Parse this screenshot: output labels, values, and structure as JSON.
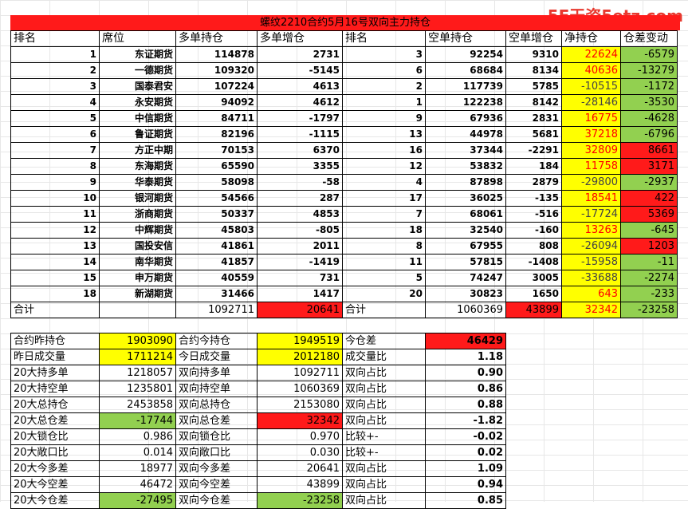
{
  "watermark": "5E天资5etz.com",
  "title": "螺纹2210合约5月16号双向主力持仓",
  "headers": [
    "排名",
    "席位",
    "多单持仓",
    "多单增仓",
    "排名",
    "空单持仓",
    "空单增仓",
    "净持仓",
    "仓差变动"
  ],
  "rows": [
    {
      "rank": "1",
      "seat": "东证期货",
      "long": "114878",
      "long_chg": "2731",
      "srank": "3",
      "short": "92254",
      "short_chg": "9310",
      "net": "22624",
      "diff": "-6579"
    },
    {
      "rank": "2",
      "seat": "一德期货",
      "long": "109320",
      "long_chg": "-5145",
      "srank": "6",
      "short": "68684",
      "short_chg": "8134",
      "net": "40636",
      "diff": "-13279"
    },
    {
      "rank": "3",
      "seat": "国泰君安",
      "long": "107224",
      "long_chg": "4613",
      "srank": "2",
      "short": "117739",
      "short_chg": "5785",
      "net": "-10515",
      "diff": "-1172"
    },
    {
      "rank": "4",
      "seat": "永安期货",
      "long": "94092",
      "long_chg": "4612",
      "srank": "1",
      "short": "122238",
      "short_chg": "8142",
      "net": "-28146",
      "diff": "-3530"
    },
    {
      "rank": "5",
      "seat": "中信期货",
      "long": "84711",
      "long_chg": "-1797",
      "srank": "9",
      "short": "67936",
      "short_chg": "2831",
      "net": "16775",
      "diff": "-4628"
    },
    {
      "rank": "6",
      "seat": "鲁证期货",
      "long": "82196",
      "long_chg": "-1115",
      "srank": "13",
      "short": "44978",
      "short_chg": "5681",
      "net": "37218",
      "diff": "-6796"
    },
    {
      "rank": "7",
      "seat": "方正中期",
      "long": "70153",
      "long_chg": "6370",
      "srank": "16",
      "short": "37344",
      "short_chg": "-2291",
      "net": "32809",
      "diff": "8661"
    },
    {
      "rank": "8",
      "seat": "东海期货",
      "long": "65590",
      "long_chg": "3355",
      "srank": "12",
      "short": "53832",
      "short_chg": "184",
      "net": "11758",
      "diff": "3171"
    },
    {
      "rank": "9",
      "seat": "华泰期货",
      "long": "58098",
      "long_chg": "-58",
      "srank": "4",
      "short": "87898",
      "short_chg": "2879",
      "net": "-29800",
      "diff": "-2937"
    },
    {
      "rank": "10",
      "seat": "银河期货",
      "long": "54566",
      "long_chg": "287",
      "srank": "17",
      "short": "36025",
      "short_chg": "-135",
      "net": "18541",
      "diff": "422"
    },
    {
      "rank": "11",
      "seat": "浙商期货",
      "long": "50337",
      "long_chg": "4853",
      "srank": "7",
      "short": "68061",
      "short_chg": "-516",
      "net": "-17724",
      "diff": "5369"
    },
    {
      "rank": "12",
      "seat": "中辉期货",
      "long": "45803",
      "long_chg": "-805",
      "srank": "18",
      "short": "32540",
      "short_chg": "-160",
      "net": "13263",
      "diff": "-645"
    },
    {
      "rank": "13",
      "seat": "国投安信",
      "long": "41861",
      "long_chg": "2011",
      "srank": "8",
      "short": "67955",
      "short_chg": "808",
      "net": "-26094",
      "diff": "1203"
    },
    {
      "rank": "14",
      "seat": "南华期货",
      "long": "41857",
      "long_chg": "-1419",
      "srank": "11",
      "short": "57815",
      "short_chg": "-1408",
      "net": "-15958",
      "diff": "-11"
    },
    {
      "rank": "15",
      "seat": "申万期货",
      "long": "40559",
      "long_chg": "731",
      "srank": "5",
      "short": "74247",
      "short_chg": "3005",
      "net": "-33688",
      "diff": "-2274"
    },
    {
      "rank": "18",
      "seat": "新湖期货",
      "long": "31466",
      "long_chg": "1417",
      "srank": "20",
      "short": "30823",
      "short_chg": "1650",
      "net": "643",
      "diff": "-233"
    }
  ],
  "total": {
    "label": "合计",
    "long": "1092711",
    "long_chg": "20641",
    "slabel": "合计",
    "short": "1060369",
    "short_chg": "43899",
    "net": "32342",
    "diff": "-23258"
  },
  "summary": [
    {
      "l1": "合约昨持仓",
      "v1": "1903090",
      "l2": "合约今持仓",
      "v2": "1949519",
      "l3": "今仓差",
      "v3": "46429"
    },
    {
      "l1": "昨日成交量",
      "v1": "1711214",
      "l2": "今日成交量",
      "v2": "2012180",
      "l3": "成交量比",
      "v3": "1.18"
    },
    {
      "l1": "20大持多单",
      "v1": "1218057",
      "l2": "双向持多单",
      "v2": "1092711",
      "l3": "双向占比",
      "v3": "0.90"
    },
    {
      "l1": "20大持空单",
      "v1": "1235801",
      "l2": "双向持空单",
      "v2": "1060369",
      "l3": "双向占比",
      "v3": "0.86"
    },
    {
      "l1": "20大总持仓",
      "v1": "2453858",
      "l2": "双向总持仓",
      "v2": "2153080",
      "l3": "双向占比",
      "v3": "0.88"
    },
    {
      "l1": "20大总仓差",
      "v1": "-17744",
      "l2": "双向总仓差",
      "v2": "32342",
      "l3": "双向占比",
      "v3": "-1.82"
    },
    {
      "l1": "20大锁仓比",
      "v1": "0.986",
      "l2": "双向锁仓比",
      "v2": "0.970",
      "l3": "比较+-",
      "v3": "-0.02"
    },
    {
      "l1": "20大敞口比",
      "v1": "0.014",
      "l2": "双向敞口比",
      "v2": "0.030",
      "l3": "比较+-",
      "v3": "0.02"
    },
    {
      "l1": "20大今多差",
      "v1": "18977",
      "l2": "双向今多差",
      "v2": "20641",
      "l3": "双向占比",
      "v3": "1.09"
    },
    {
      "l1": "20大今空差",
      "v1": "46472",
      "l2": "双向今空差",
      "v2": "43899",
      "l3": "双向占比",
      "v3": "0.94"
    },
    {
      "l1": "20大今仓差",
      "v1": "-27495",
      "l2": "双向今仓差",
      "v2": "-23258",
      "l3": "双向占比",
      "v3": "0.85"
    }
  ],
  "colors": {
    "red": "#ff1a1a",
    "yellow": "#ffff00",
    "green": "#92d050"
  }
}
